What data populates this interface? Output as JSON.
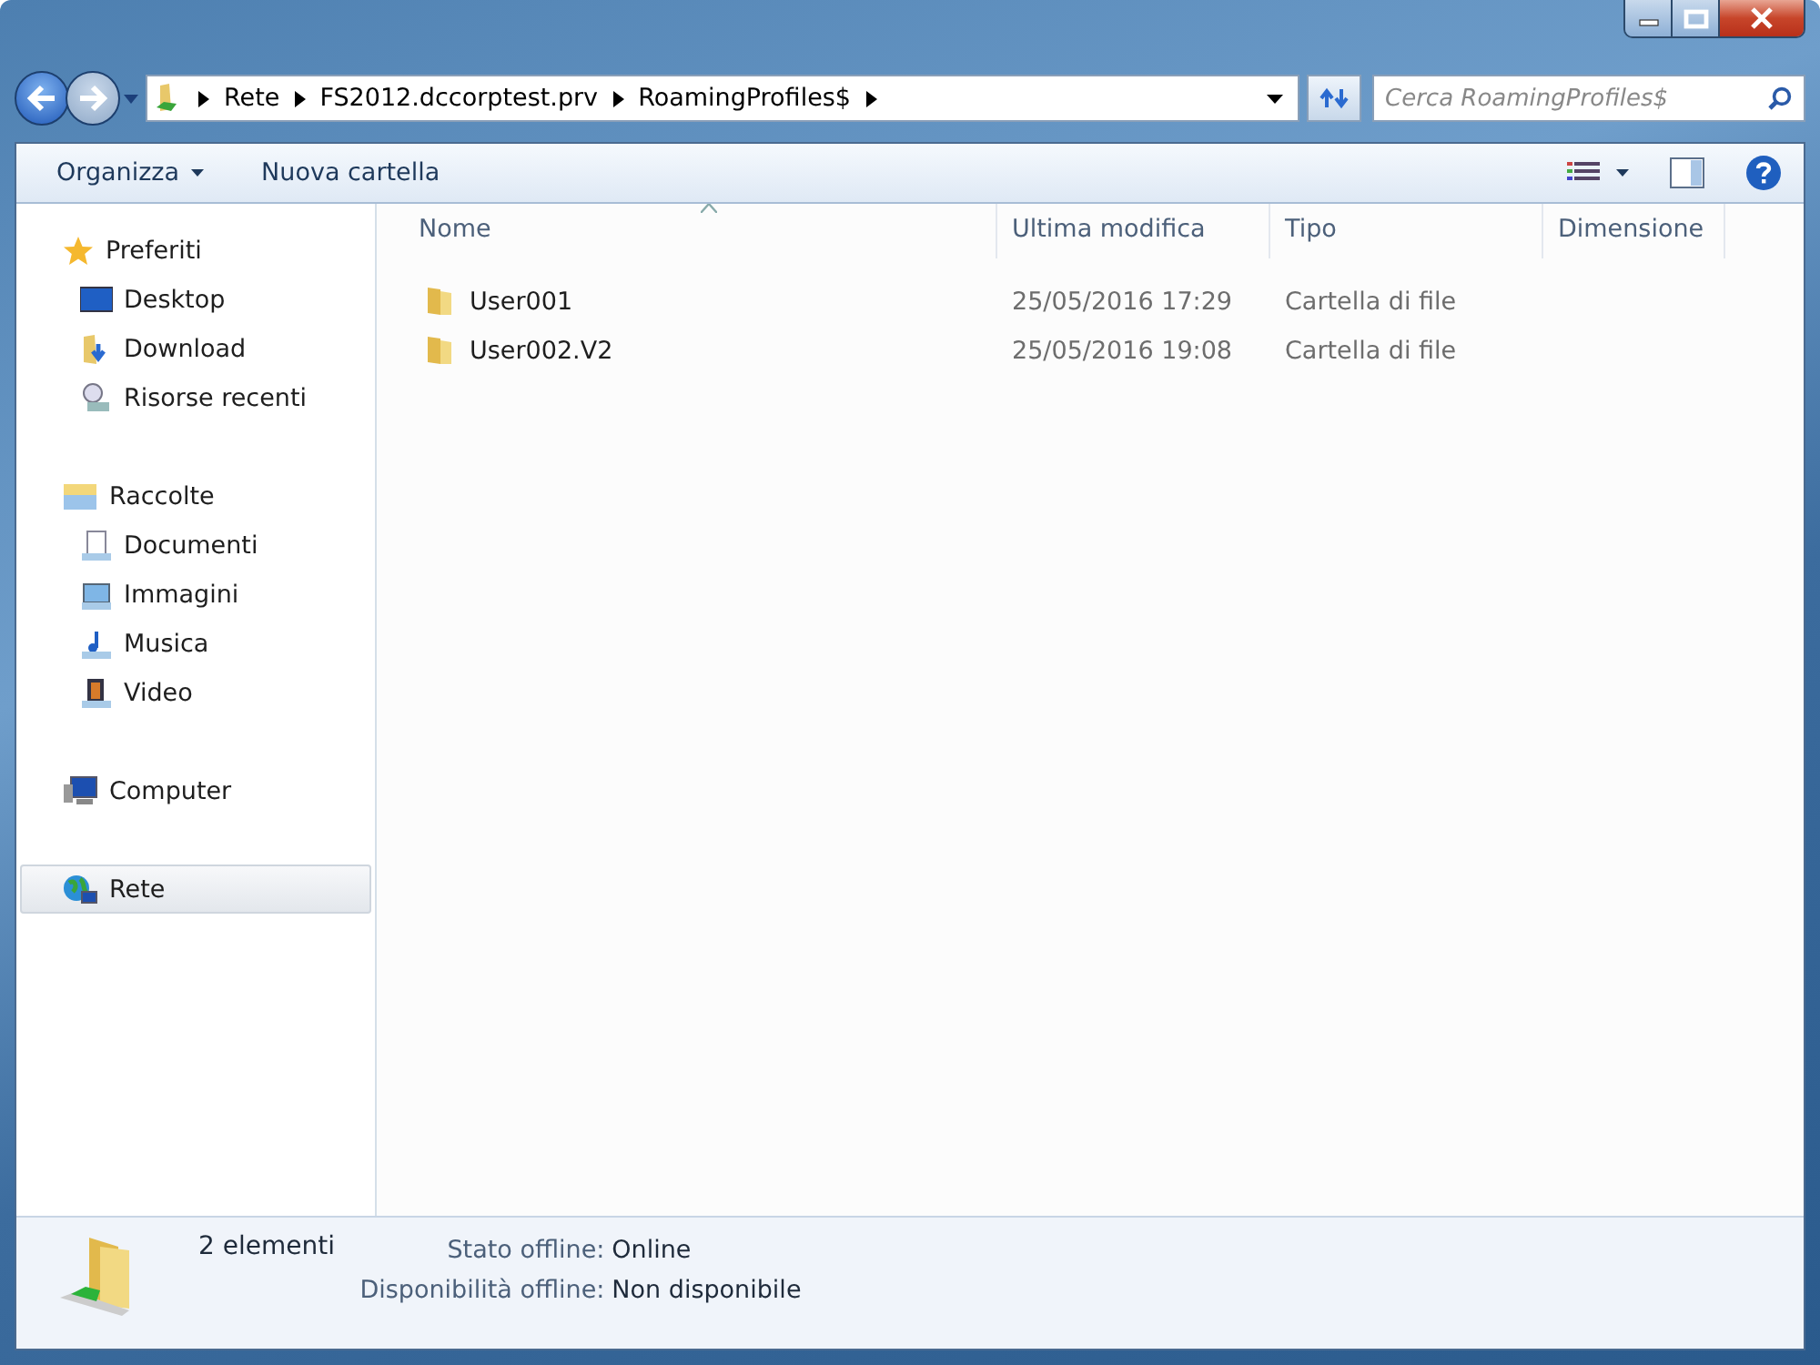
{
  "address": {
    "crumbs": [
      "Rete",
      "FS2012.dccorptest.prv",
      "RoamingProfiles$"
    ]
  },
  "search": {
    "placeholder": "Cerca RoamingProfiles$"
  },
  "toolbar": {
    "items": [
      {
        "label": "Organizza",
        "dropdown": true
      },
      {
        "label": "Nuova cartella",
        "dropdown": false
      }
    ]
  },
  "sidebar": {
    "groups": [
      {
        "label": "Preferiti",
        "selected": false,
        "children": [
          {
            "label": "Desktop",
            "selected": false
          },
          {
            "label": "Download",
            "selected": false
          },
          {
            "label": "Risorse recenti",
            "selected": false
          }
        ]
      },
      {
        "label": "Raccolte",
        "selected": false,
        "children": [
          {
            "label": "Documenti",
            "selected": false
          },
          {
            "label": "Immagini",
            "selected": false
          },
          {
            "label": "Musica",
            "selected": false
          },
          {
            "label": "Video",
            "selected": false
          }
        ]
      },
      {
        "label": "Computer",
        "selected": false
      },
      {
        "label": "Rete",
        "selected": true
      }
    ]
  },
  "table": {
    "columns": [
      {
        "label": "Nome",
        "sorted": true
      },
      {
        "label": "Ultima modifica",
        "sorted": false
      },
      {
        "label": "Tipo",
        "sorted": false
      },
      {
        "label": "Dimensione",
        "sorted": false
      }
    ],
    "rows": [
      {
        "name": "User001",
        "modified": "25/05/2016 17:29",
        "type": "Cartella di file"
      },
      {
        "name": "User002.V2",
        "modified": "25/05/2016 19:08",
        "type": "Cartella di file"
      }
    ]
  },
  "status_bar": {
    "count": "2 elementi",
    "fields": [
      {
        "label": "Stato offline:",
        "value": "Online"
      },
      {
        "label": "Disponibilità offline:",
        "value": "Non disponibile"
      }
    ]
  }
}
